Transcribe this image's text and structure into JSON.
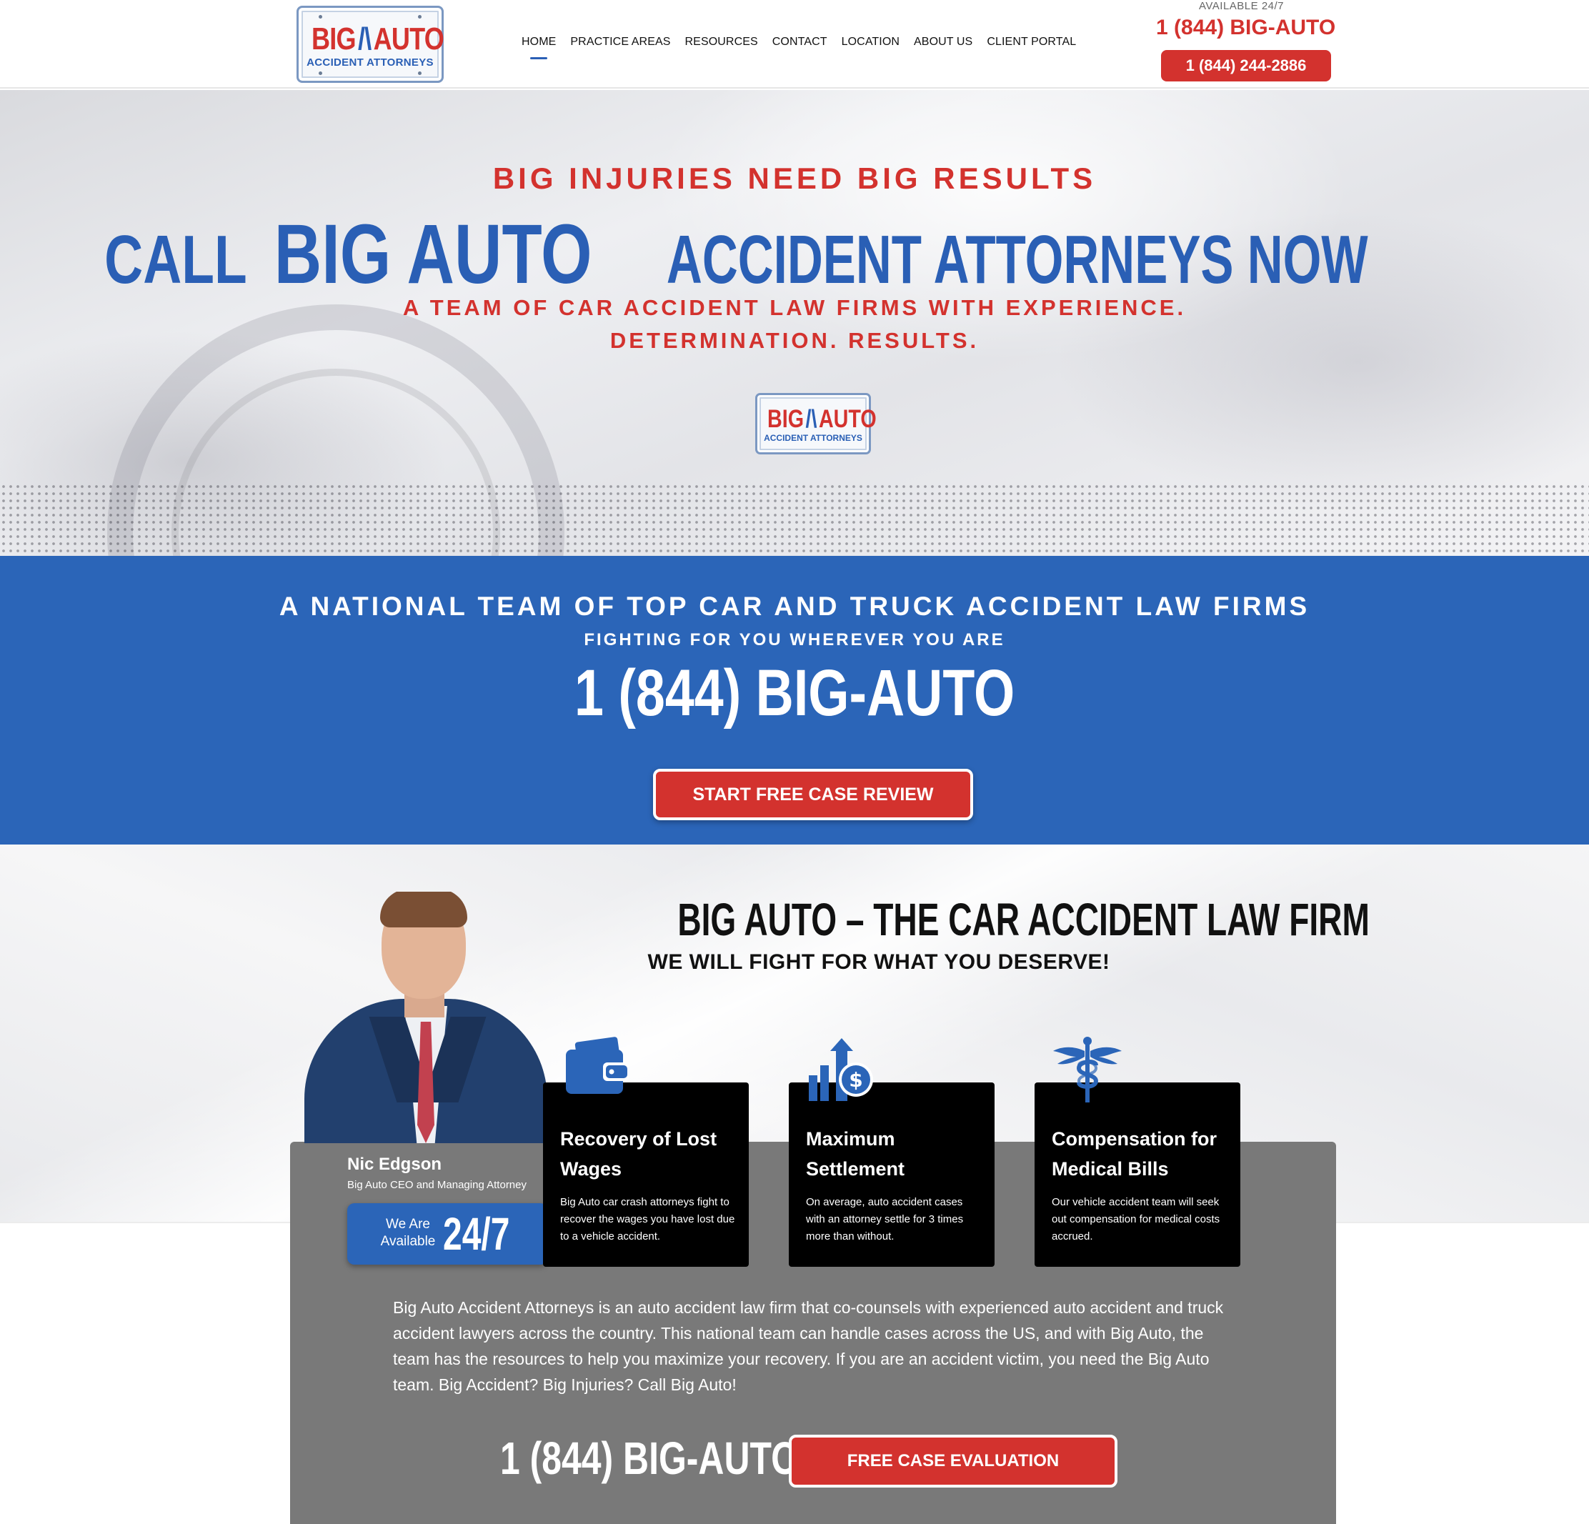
{
  "brand": {
    "logo_big": "BIG",
    "logo_auto": "AUTO",
    "logo_sub": "ACCIDENT ATTORNEYS",
    "colors": {
      "red": "#d3322e",
      "blue": "#2b65b8",
      "gray_panel": "#797979",
      "card": "#000000"
    }
  },
  "nav": {
    "items": [
      {
        "label": "HOME",
        "active": true
      },
      {
        "label": "PRACTICE AREAS"
      },
      {
        "label": "RESOURCES"
      },
      {
        "label": "CONTACT"
      },
      {
        "label": "LOCATION"
      },
      {
        "label": "ABOUT US"
      },
      {
        "label": "CLIENT PORTAL"
      }
    ]
  },
  "header": {
    "available": "AVAILABLE 24/7",
    "phone_text": "1 (844) BIG-AUTO",
    "phone_button": "1 (844) 244-2886"
  },
  "hero": {
    "kicker": "BIG INJURIES NEED BIG RESULTS",
    "title_call": "CALL",
    "title_bigauto": "BIG AUTO",
    "title_rest": "ACCIDENT ATTORNEYS NOW",
    "subtitle": "A TEAM OF CAR ACCIDENT LAW FIRMS WITH EXPERIENCE. DETERMINATION. RESULTS."
  },
  "band": {
    "title": "A NATIONAL TEAM OF TOP CAR AND TRUCK ACCIDENT LAW FIRMS",
    "subtitle": "FIGHTING FOR YOU WHEREVER YOU ARE",
    "phone": "1 (844) BIG-AUTO",
    "button": "START FREE CASE REVIEW"
  },
  "about": {
    "title": "BIG AUTO – THE CAR ACCIDENT LAW FIRM",
    "subtitle": "WE WILL FIGHT FOR WHAT YOU DESERVE!",
    "person_name": "Nic Edgson",
    "person_role": "Big Auto CEO and Managing Attorney",
    "available_label": "We Are Available",
    "available_value": "24/7",
    "cards": [
      {
        "icon": "wallet-icon",
        "title": "Recovery of Lost Wages",
        "text": "Big Auto car crash attorneys fight to recover the wages you have lost due to a vehicle accident."
      },
      {
        "icon": "settlement-chart-icon",
        "title": "Maximum Settlement",
        "text": "On average, auto accident cases with an attorney settle for 3 times more than without."
      },
      {
        "icon": "caduceus-icon",
        "title": "Compensation for Medical Bills",
        "text": "Our vehicle accident team will seek out compensation for medical costs accrued."
      }
    ],
    "paragraph": "Big Auto Accident Attorneys is an auto accident law firm that co-counsels with experienced auto accident and truck accident lawyers across the country.  This national team can handle cases across the US, and with Big Auto, the team has the resources to help you maximize your recovery.  If you are an accident victim, you need the Big Auto team.  Big Accident?  Big Injuries? Call Big Auto!",
    "phone": "1 (844) BIG-AUTO",
    "button": "FREE CASE EVALUATION"
  }
}
